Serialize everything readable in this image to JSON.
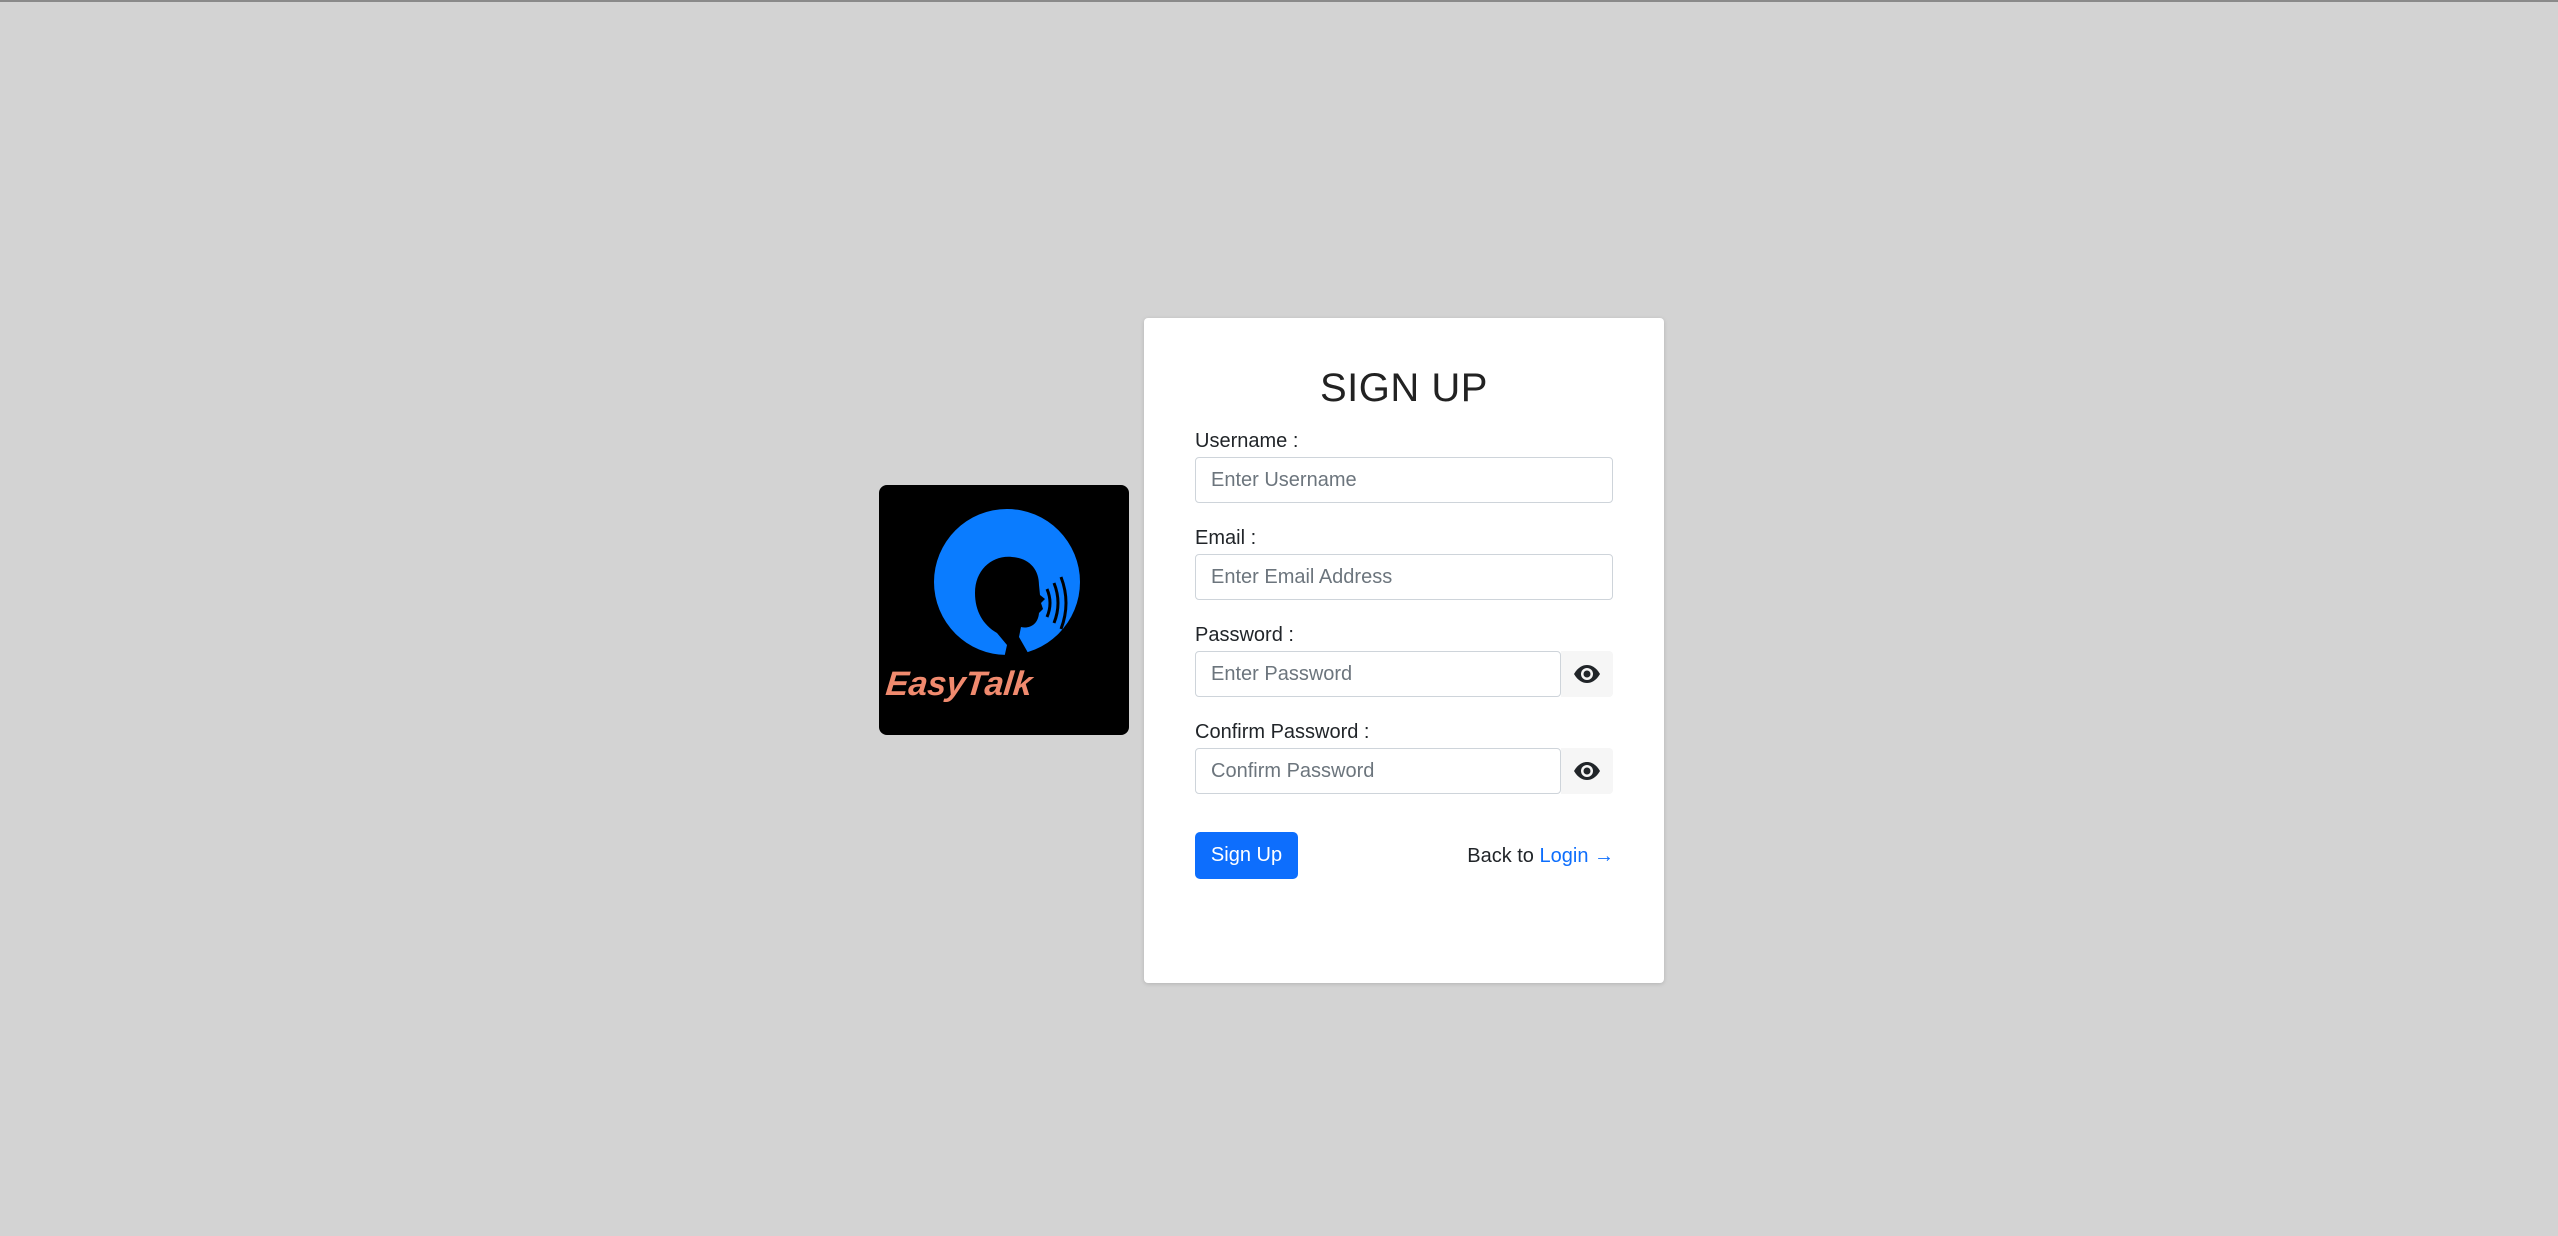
{
  "logo": {
    "text": "EasyTalk",
    "colors": {
      "background": "#000000",
      "circle": "#0a7cff",
      "text": "#f08a6e"
    }
  },
  "form": {
    "title": "SIGN UP",
    "fields": [
      {
        "label": "Username :",
        "placeholder": "Enter Username",
        "value": ""
      },
      {
        "label": "Email :",
        "placeholder": "Enter Email Address",
        "value": ""
      },
      {
        "label": "Password :",
        "placeholder": "Enter Password",
        "value": "",
        "toggle_icon": "eye-icon"
      },
      {
        "label": "Confirm Password :",
        "placeholder": "Confirm Password",
        "value": "",
        "toggle_icon": "eye-icon"
      }
    ],
    "submit_label": "Sign Up",
    "back_text": "Back to ",
    "login_link": "Login →"
  },
  "colors": {
    "page_background": "#d3d3d3",
    "primary": "#0d6efd"
  }
}
